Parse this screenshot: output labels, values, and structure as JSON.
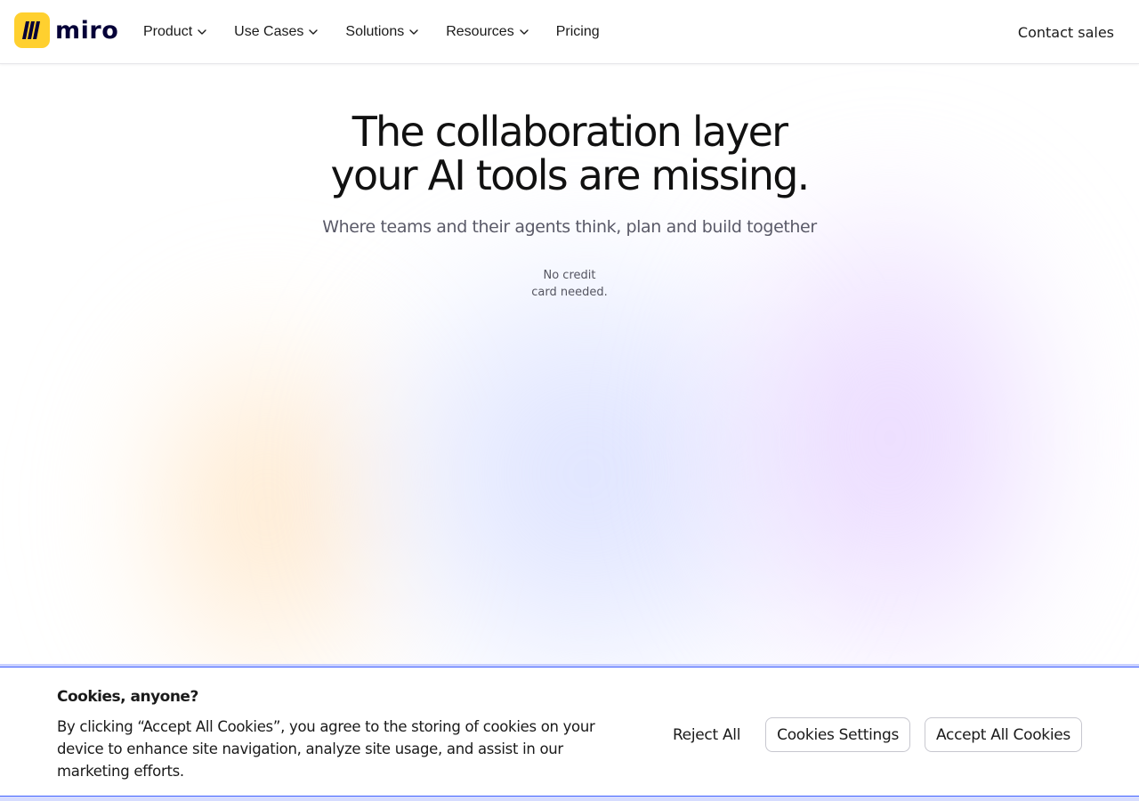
{
  "header": {
    "logo_text": "miro",
    "logo_icon": "miro-logo-icon",
    "nav": [
      {
        "label": "Product",
        "has_dropdown": true
      },
      {
        "label": "Use Cases",
        "has_dropdown": true
      },
      {
        "label": "Solutions",
        "has_dropdown": true
      },
      {
        "label": "Resources",
        "has_dropdown": true
      },
      {
        "label": "Pricing",
        "has_dropdown": false
      }
    ],
    "contact_sales": "Contact sales"
  },
  "hero": {
    "title_line1": "The collaboration layer",
    "title_line2": "your AI tools are missing.",
    "subtitle": "Where teams and their agents think, plan and build together",
    "note_line1": "No credit",
    "note_line2": "card needed."
  },
  "cookie_banner": {
    "title": "Cookies, anyone?",
    "text": "By clicking “Accept All Cookies”, you agree to the storing of cookies on your device to enhance site navigation, analyze site usage, and assist in our marketing efforts.",
    "reject_label": "Reject All",
    "settings_label": "Cookies Settings",
    "accept_label": "Accept All Cookies"
  },
  "colors": {
    "brand_yellow": "#ffd02f",
    "brand_dark": "#050038",
    "accent_blue": "#4262ff"
  }
}
